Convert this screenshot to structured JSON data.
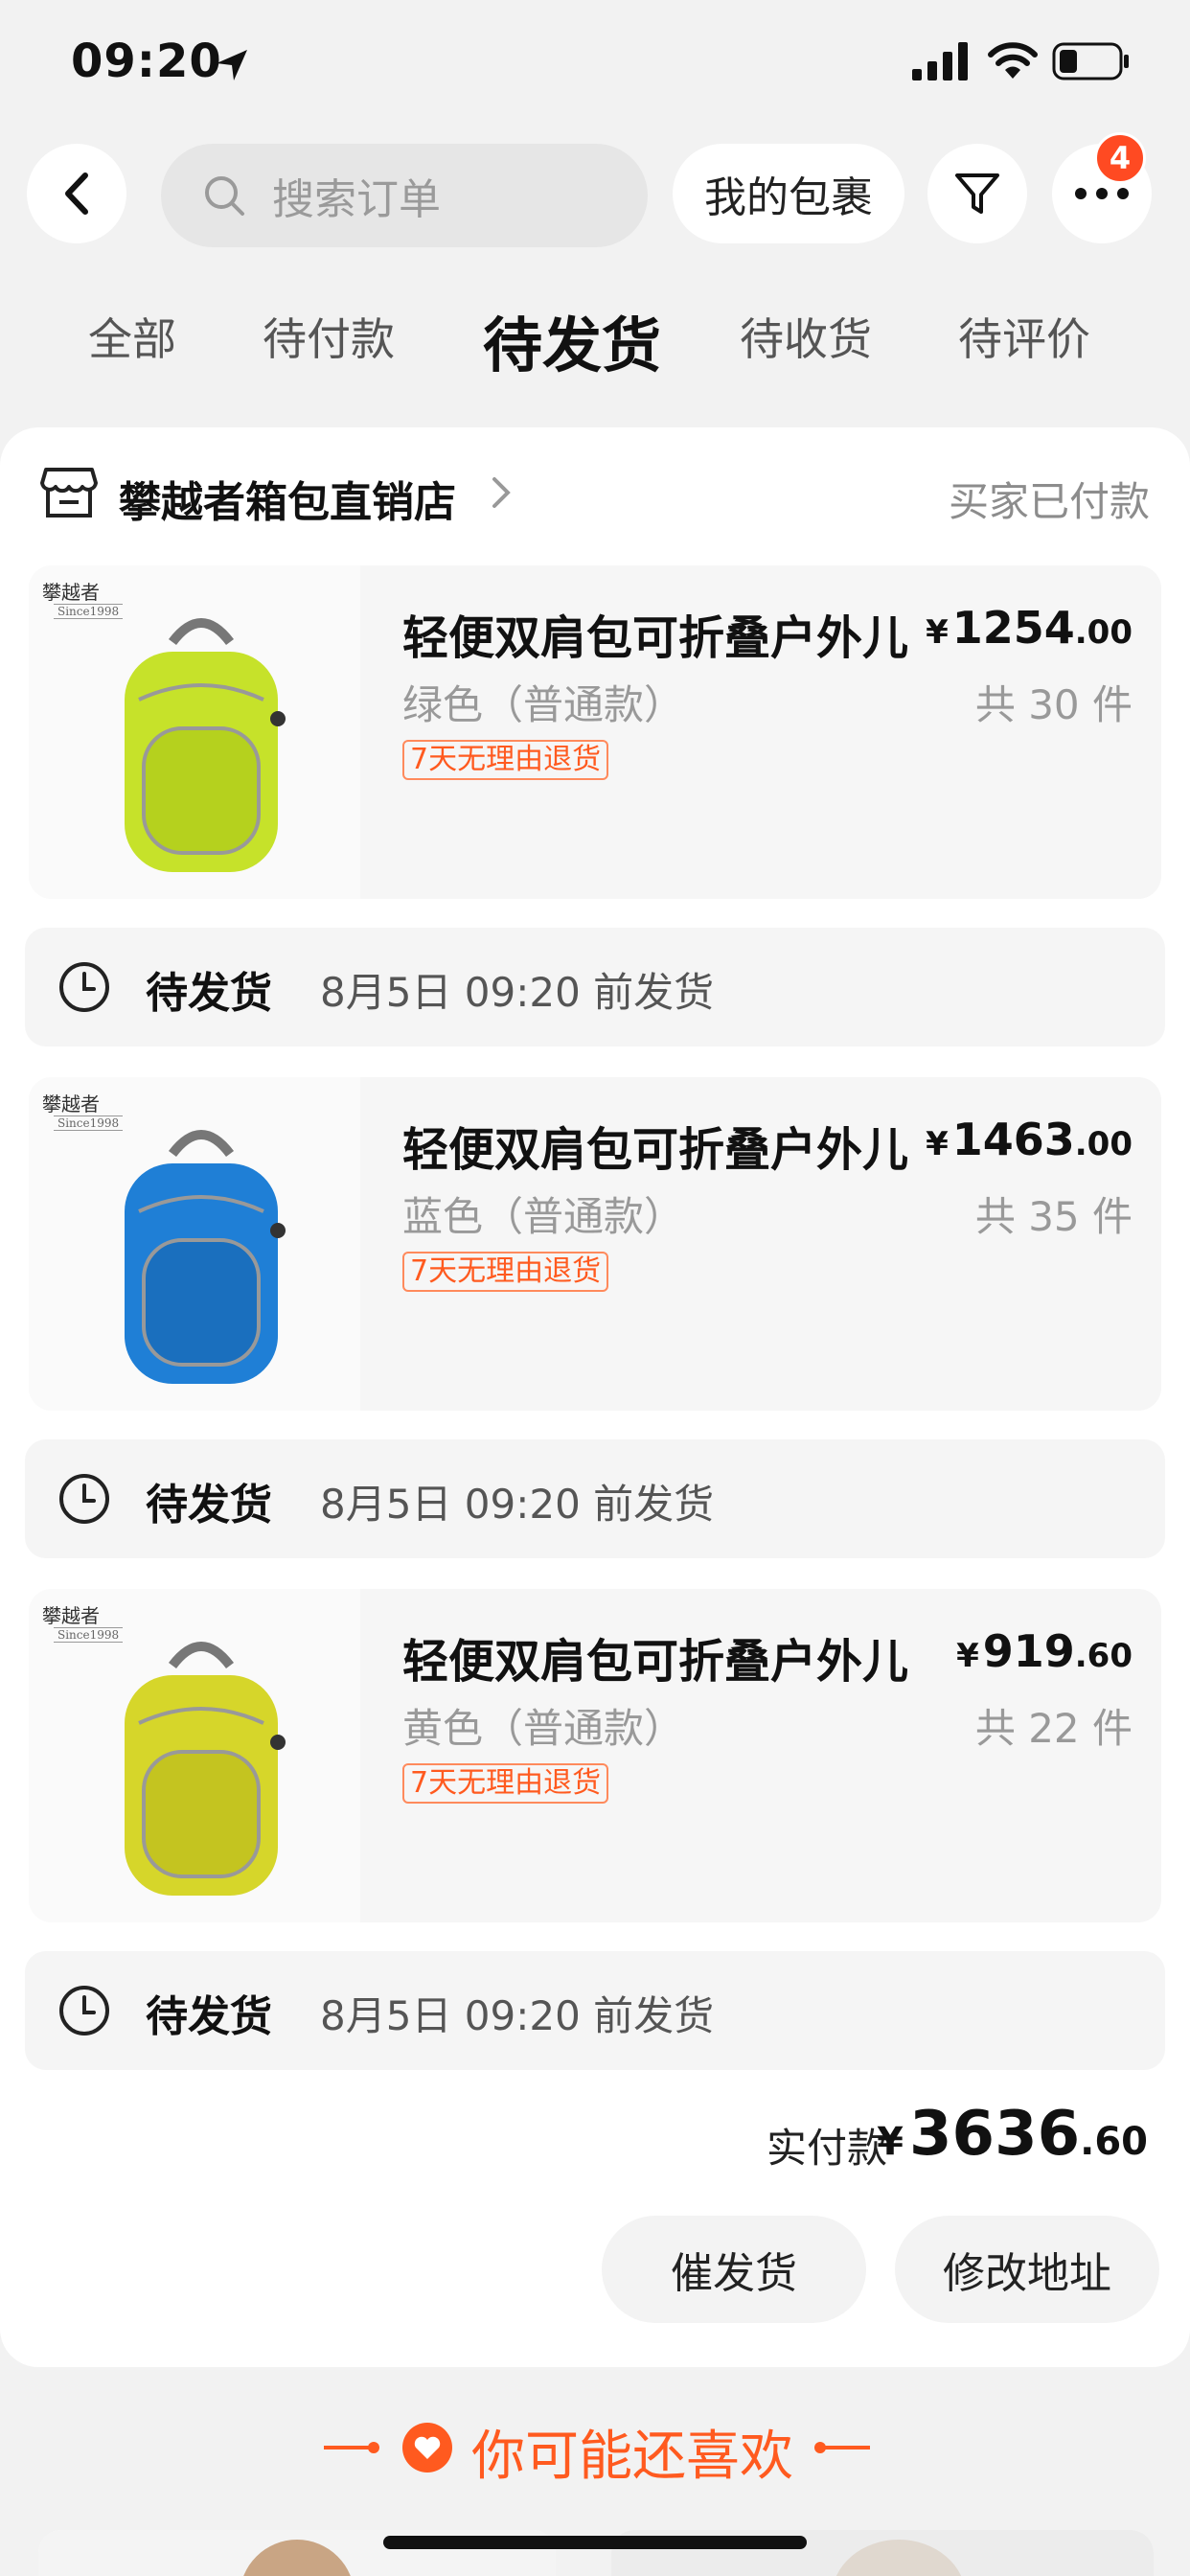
{
  "status_bar": {
    "time": "09:20"
  },
  "nav": {
    "search_placeholder": "搜索订单",
    "packages_label": "我的包裹",
    "badge_count": "4"
  },
  "tabs": [
    {
      "label": "全部",
      "active": false
    },
    {
      "label": "待付款",
      "active": false
    },
    {
      "label": "待发货",
      "active": true
    },
    {
      "label": "待收货",
      "active": false
    },
    {
      "label": "待评价",
      "active": false
    }
  ],
  "order": {
    "shop_name": "攀越者箱包直销店",
    "status": "买家已付款",
    "items": [
      {
        "title": "轻便双肩包可折叠户外儿",
        "price_yen": "¥",
        "price_int": "1254",
        "price_dec": ".00",
        "variant": "绿色（普通款）",
        "qty": "共 30 件",
        "tag": "7天无理由退货",
        "color": "#c6e22a",
        "brand": "攀越者",
        "brand_sub": "Since1998",
        "ship_status": "待发货",
        "ship_time": "8月5日 09:20 前发货"
      },
      {
        "title": "轻便双肩包可折叠户外儿",
        "price_yen": "¥",
        "price_int": "1463",
        "price_dec": ".00",
        "variant": "蓝色（普通款）",
        "qty": "共 35 件",
        "tag": "7天无理由退货",
        "color": "#1f7fd6",
        "brand": "攀越者",
        "brand_sub": "Since1998",
        "ship_status": "待发货",
        "ship_time": "8月5日 09:20 前发货"
      },
      {
        "title": "轻便双肩包可折叠户外儿",
        "price_yen": "¥",
        "price_int": "919",
        "price_dec": ".60",
        "variant": "黄色（普通款）",
        "qty": "共 22 件",
        "tag": "7天无理由退货",
        "color": "#d6d62a",
        "brand": "攀越者",
        "brand_sub": "Since1998",
        "ship_status": "待发货",
        "ship_time": "8月5日 09:20 前发货"
      }
    ],
    "total_label": "实付款",
    "total_yen": "¥",
    "total_int": "3636",
    "total_dec": ".60",
    "actions": [
      "催发货",
      "修改地址"
    ]
  },
  "recommend": {
    "title": "你可能还喜欢"
  },
  "colors": {
    "accent": "#ff5a1f",
    "badge": "#ff4a22"
  }
}
